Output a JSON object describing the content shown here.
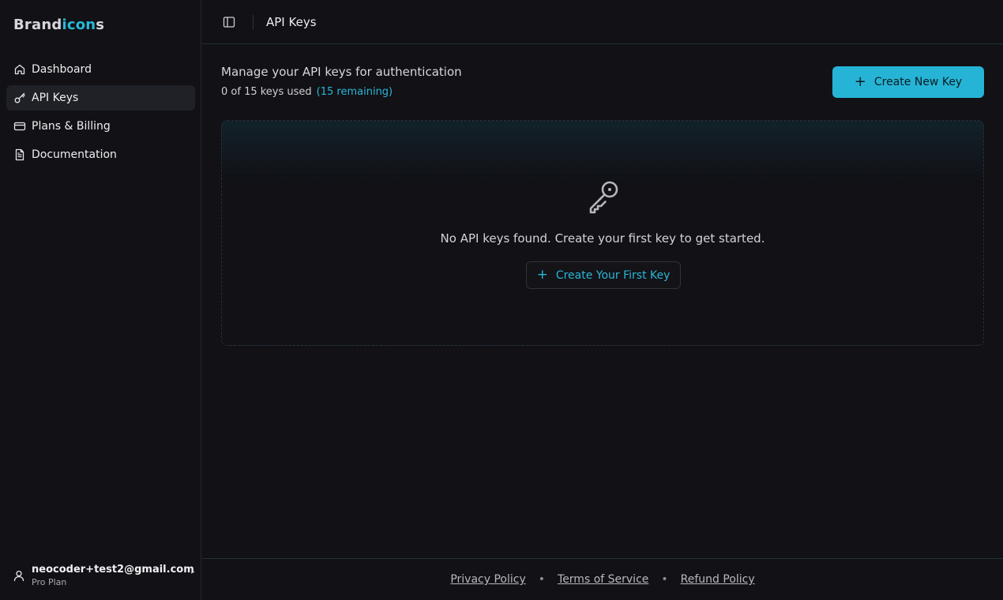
{
  "brand": {
    "part1": "Brand",
    "part2": "icon",
    "part3": "s",
    "accent_color": "#29b9d8"
  },
  "sidebar": {
    "items": [
      {
        "label": "Dashboard",
        "icon": "home-icon"
      },
      {
        "label": "API Keys",
        "icon": "key-icon",
        "active": true
      },
      {
        "label": "Plans & Billing",
        "icon": "credit-card-icon"
      },
      {
        "label": "Documentation",
        "icon": "document-icon"
      }
    ],
    "user": {
      "email": "neocoder+test2@gmail.com",
      "plan": "Pro Plan",
      "icon": "user-icon"
    }
  },
  "topbar": {
    "title": "API Keys",
    "toggle_icon": "sidebar-toggle-icon"
  },
  "main": {
    "description": "Manage your API keys for authentication",
    "usage_text": "0 of 15 keys used",
    "remaining_text": "(15 remaining)",
    "create_button_label": "Create New Key",
    "empty_state": {
      "icon": "key-icon",
      "message": "No API keys found. Create your first key to get started.",
      "button_label": "Create Your First Key"
    }
  },
  "footer": {
    "links": [
      "Privacy Policy",
      "Terms of Service",
      "Refund Policy"
    ],
    "separator": "•"
  },
  "colors": {
    "accent": "#25b4d6",
    "background": "#111116",
    "sidebar_active": "#1f2127"
  }
}
